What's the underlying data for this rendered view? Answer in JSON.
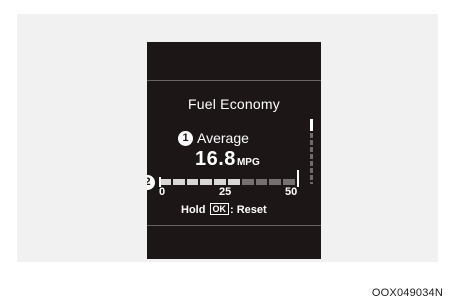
{
  "display": {
    "title": "Fuel Economy",
    "callout_1": "1",
    "callout_2": "2",
    "metric_label": "Average",
    "value": "16.8",
    "unit": "MPG",
    "gauge": {
      "min_label": "0",
      "mid_label": "25",
      "max_label": "50",
      "min": 0,
      "max": 50,
      "segments": 10,
      "filled_segments": 6
    },
    "hint": {
      "prefix": "Hold",
      "key": "OK",
      "suffix": ": Reset"
    }
  },
  "figure_code": "OOX049034N"
}
